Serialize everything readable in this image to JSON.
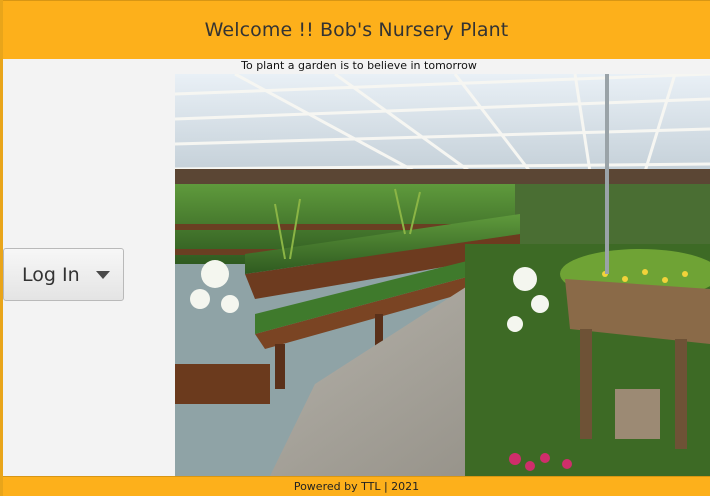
{
  "header": {
    "title": "Welcome !! Bob's Nursery Plant"
  },
  "main": {
    "tagline": "To plant a garden is to believe in tomorrow",
    "photo_subject": "greenhouse-nursery-photo"
  },
  "login": {
    "label": "Log In"
  },
  "footer": {
    "text": "Powered by TTL | 2021"
  },
  "colors": {
    "brand": "#fdb01b",
    "background": "#f3f3f3"
  }
}
